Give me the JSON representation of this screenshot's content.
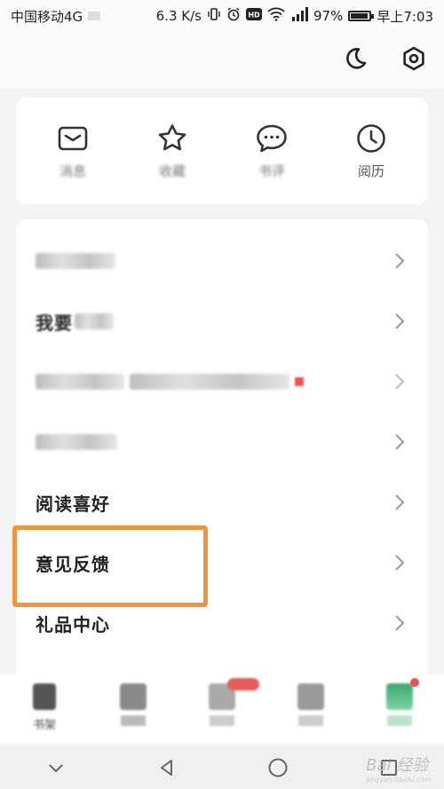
{
  "status_bar": {
    "carrier": "中国移动4G",
    "speed": "6.3 K/s",
    "battery": "97%",
    "battery_level": 0.97,
    "time": "早上7:03",
    "icons": [
      "vibrate-icon",
      "alarm-icon",
      "hd-icon",
      "wifi-icon",
      "signal-icon",
      "battery-icon"
    ]
  },
  "top_actions": {
    "icons": [
      "moon-icon",
      "settings-icon"
    ]
  },
  "quick_actions": [
    {
      "label": "消息",
      "icon": "mail-icon"
    },
    {
      "label": "收藏",
      "icon": "star-icon"
    },
    {
      "label": "书评",
      "icon": "comment-icon"
    },
    {
      "label": "阅历",
      "icon": "clock-icon"
    }
  ],
  "menu": {
    "rows": [
      {
        "label": "",
        "blurred": true
      },
      {
        "label": "我要",
        "blurred": true
      },
      {
        "label": "",
        "blurred": true
      },
      {
        "label": "",
        "blurred": true
      },
      {
        "label": "阅读喜好",
        "blurred": false
      },
      {
        "label": "意见反馈",
        "blurred": false
      },
      {
        "label": "礼品中心",
        "blurred": false
      }
    ]
  },
  "tabbar": {
    "items": [
      {
        "label": "书架"
      },
      {
        "label": ""
      },
      {
        "label": ""
      },
      {
        "label": ""
      },
      {
        "label": ""
      }
    ]
  },
  "navbar": {
    "icons": [
      "chevron-down-icon",
      "back-icon",
      "home-icon",
      "recent-icon"
    ]
  },
  "watermark": {
    "text": "Bai 经验",
    "sub": "jingyan.baidu.com"
  },
  "colors": {
    "highlight": "#f0953f",
    "badge": "#f05151"
  }
}
